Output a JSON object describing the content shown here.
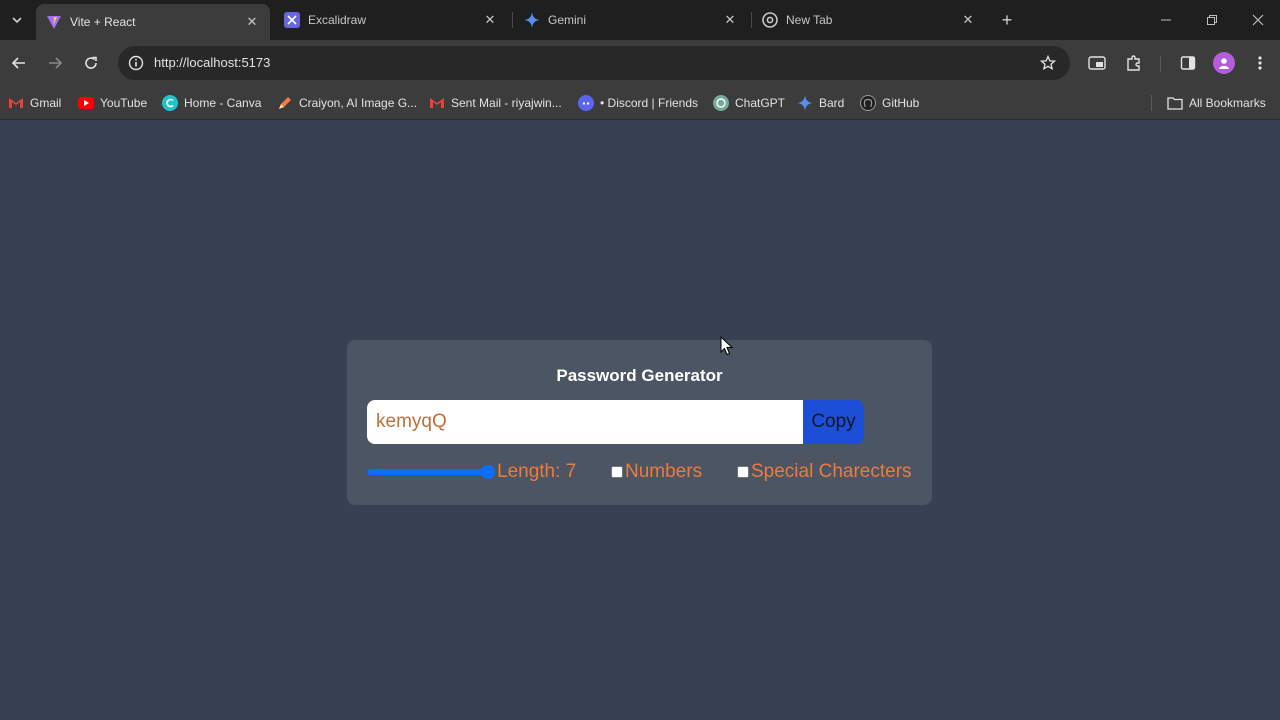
{
  "browser": {
    "tabs": [
      {
        "title": "Vite + React",
        "icon": "vite-icon",
        "active": true
      },
      {
        "title": "Excalidraw",
        "icon": "excalidraw-icon",
        "active": false
      },
      {
        "title": "Gemini",
        "icon": "gemini-icon",
        "active": false
      },
      {
        "title": "New Tab",
        "icon": "chrome-icon",
        "active": false
      }
    ],
    "url": "http://localhost:5173",
    "bookmarks": [
      {
        "label": "Gmail",
        "icon": "gmail-icon"
      },
      {
        "label": "YouTube",
        "icon": "youtube-icon"
      },
      {
        "label": "Home - Canva",
        "icon": "canva-icon"
      },
      {
        "label": "Craiyon, AI Image G...",
        "icon": "craiyon-icon"
      },
      {
        "label": "Sent Mail - riyajwin...",
        "icon": "gmail-icon"
      },
      {
        "label": "• Discord | Friends",
        "icon": "discord-icon"
      },
      {
        "label": "ChatGPT",
        "icon": "chatgpt-icon"
      },
      {
        "label": "Bard",
        "icon": "bard-icon"
      },
      {
        "label": "GitHub",
        "icon": "github-icon"
      }
    ],
    "all_bookmarks_label": "All Bookmarks"
  },
  "app": {
    "title": "Password Generator",
    "password_value": "kemyqQ",
    "copy_label": "Copy",
    "length_label": "Length: 7",
    "length_slider_fraction": 1.0,
    "numbers_label": "Numbers",
    "numbers_checked": false,
    "special_label": "Special Charecters",
    "special_checked": false
  },
  "colors": {
    "page_bg": "#374151",
    "card_bg": "#4b5563",
    "accent_orange": "#f07a3a",
    "copy_button": "#1d4ed8",
    "slider_blue": "#0b6efd"
  }
}
